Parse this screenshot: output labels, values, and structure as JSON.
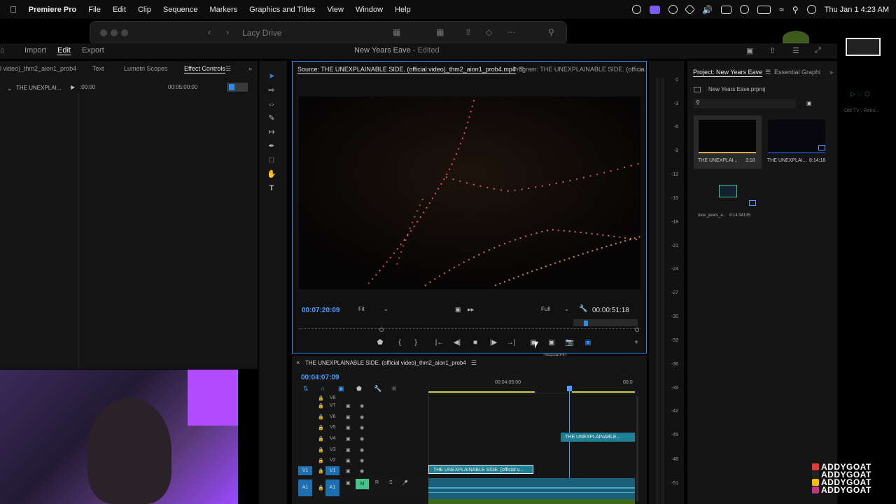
{
  "menubar": {
    "items": [
      "Premiere Pro",
      "File",
      "Edit",
      "Clip",
      "Sequence",
      "Markers",
      "Graphics and Titles",
      "View",
      "Window",
      "Help"
    ],
    "clock": "Thu Jan 1  4:23 AM"
  },
  "finder_bar": {
    "title": "Lacy Drive"
  },
  "premiere": {
    "workspace_tabs": [
      "Import",
      "Edit",
      "Export"
    ],
    "project_title": "New Years Eave",
    "project_status": "- Edited"
  },
  "left_panel": {
    "tabs": [
      "l video)_thm2_aion1_prob4",
      "Text",
      "Lumetri Scopes",
      "Effect Controls"
    ],
    "clip_label": "THE UNEXPLAI...",
    "time_start": ":00:00",
    "time_mid": "00:05:00:00"
  },
  "source_monitor": {
    "tab_source": "Source: THE UNEXPLAINABLE SIDE. (official video)_thm2_aion1_prob4.mp4",
    "tab_program": "Program: THE UNEXPLAINABLE SIDE. (officia",
    "current_time": "00:07:20:09",
    "zoom": "Fit",
    "resolution": "Full",
    "duration": "00:00:51:18",
    "tooltip": "Insert (,)"
  },
  "project_panel": {
    "tab_project": "Project: New Years Eave",
    "tab_essential": "Essential Graphi",
    "file_name": "New Years Eave.prproj",
    "items": [
      {
        "name": "THE UNEXPLAI...",
        "duration": "3:18"
      },
      {
        "name": "THE UNEXPLAI...",
        "duration": "8:14:18"
      },
      {
        "name": "new_years_e...",
        "duration": "8:14:34135"
      }
    ],
    "side_text": "Old TV , Retro..."
  },
  "timeline": {
    "sequence_name": "THE UNEXPLAINABLE SIDE. (official video)_thm2_aion1_prob4",
    "timecode": "00:04:07:09",
    "ruler_label": "00:04:05:00",
    "ruler_label_2": "00:0",
    "video_tracks": [
      "V8",
      "V7",
      "V6",
      "V5",
      "V4",
      "V3",
      "V2",
      "V1"
    ],
    "audio_tracks": [
      "A1"
    ],
    "clip_v4": "THE UNEXPLAINABLE...",
    "clip_v1": "THE UNEXPLAINABLE SIDE. (official v...",
    "track_buttons": [
      "M",
      "R",
      "S"
    ],
    "source_patch": [
      "V1",
      "A1"
    ]
  },
  "audio_meter": {
    "ticks": [
      "0",
      "-3",
      "-6",
      "-9",
      "-12",
      "-15",
      "-18",
      "-21",
      "-24",
      "-27",
      "-30",
      "-33",
      "-36",
      "-39",
      "-42",
      "-45",
      "-48",
      "-51"
    ]
  },
  "watermark": [
    "ADDYGOAT",
    "ADDYGOAT",
    "ADDYGOAT",
    "ADDYGOAT"
  ],
  "colors": {
    "accent": "#2d8ceb",
    "clip_teal": "#1f7f95",
    "audio_green": "#44c48a",
    "timecode_blue": "#4a9eff"
  }
}
